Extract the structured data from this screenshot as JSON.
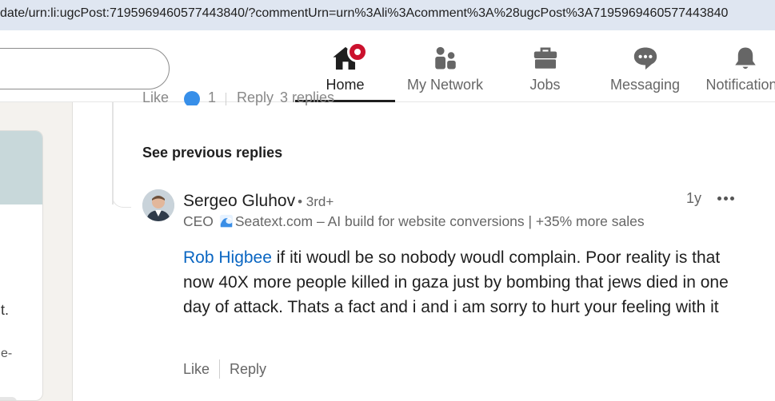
{
  "browser": {
    "url": "date/urn:li:ugcPost:7195969460577443840/?commentUrn=urn%3Ali%3Acomment%3A%28ugcPost%3A7195969460577443840"
  },
  "nav": {
    "items": [
      {
        "label": "Home",
        "icon": "home-icon",
        "active": true
      },
      {
        "label": "My Network",
        "icon": "people-icon"
      },
      {
        "label": "Jobs",
        "icon": "briefcase-icon"
      },
      {
        "label": "Messaging",
        "icon": "chat-icon"
      },
      {
        "label": "Notifications",
        "icon": "bell-icon"
      }
    ],
    "badge_color": "#cb112d"
  },
  "left_panel": {
    "text1": "t.",
    "text2": "e-"
  },
  "thread": {
    "previous_row": {
      "like": "Like",
      "reaction_count": "1",
      "reply": "Reply",
      "replies": "3 replies"
    },
    "see_previous": "See previous replies",
    "comment": {
      "author": "Sergeo Gluhov",
      "degree": "• 3rd+",
      "headline_prefix": "CEO",
      "headline_rest": "Seatext.com – AI build for website conversions | +35% more sales",
      "time": "1y",
      "mention": "Rob Higbee",
      "text": " if iti woudl be so nobody woudl complain. Poor reality is that now 40X more people killed in gaza just by bombing that jews died in one day of attack. Thats a fact and i and i am sorry to hurt your feeling with it",
      "like": "Like",
      "reply": "Reply"
    }
  },
  "colors": {
    "link": "#0a66c2",
    "reaction_blue": "#378fe9"
  }
}
